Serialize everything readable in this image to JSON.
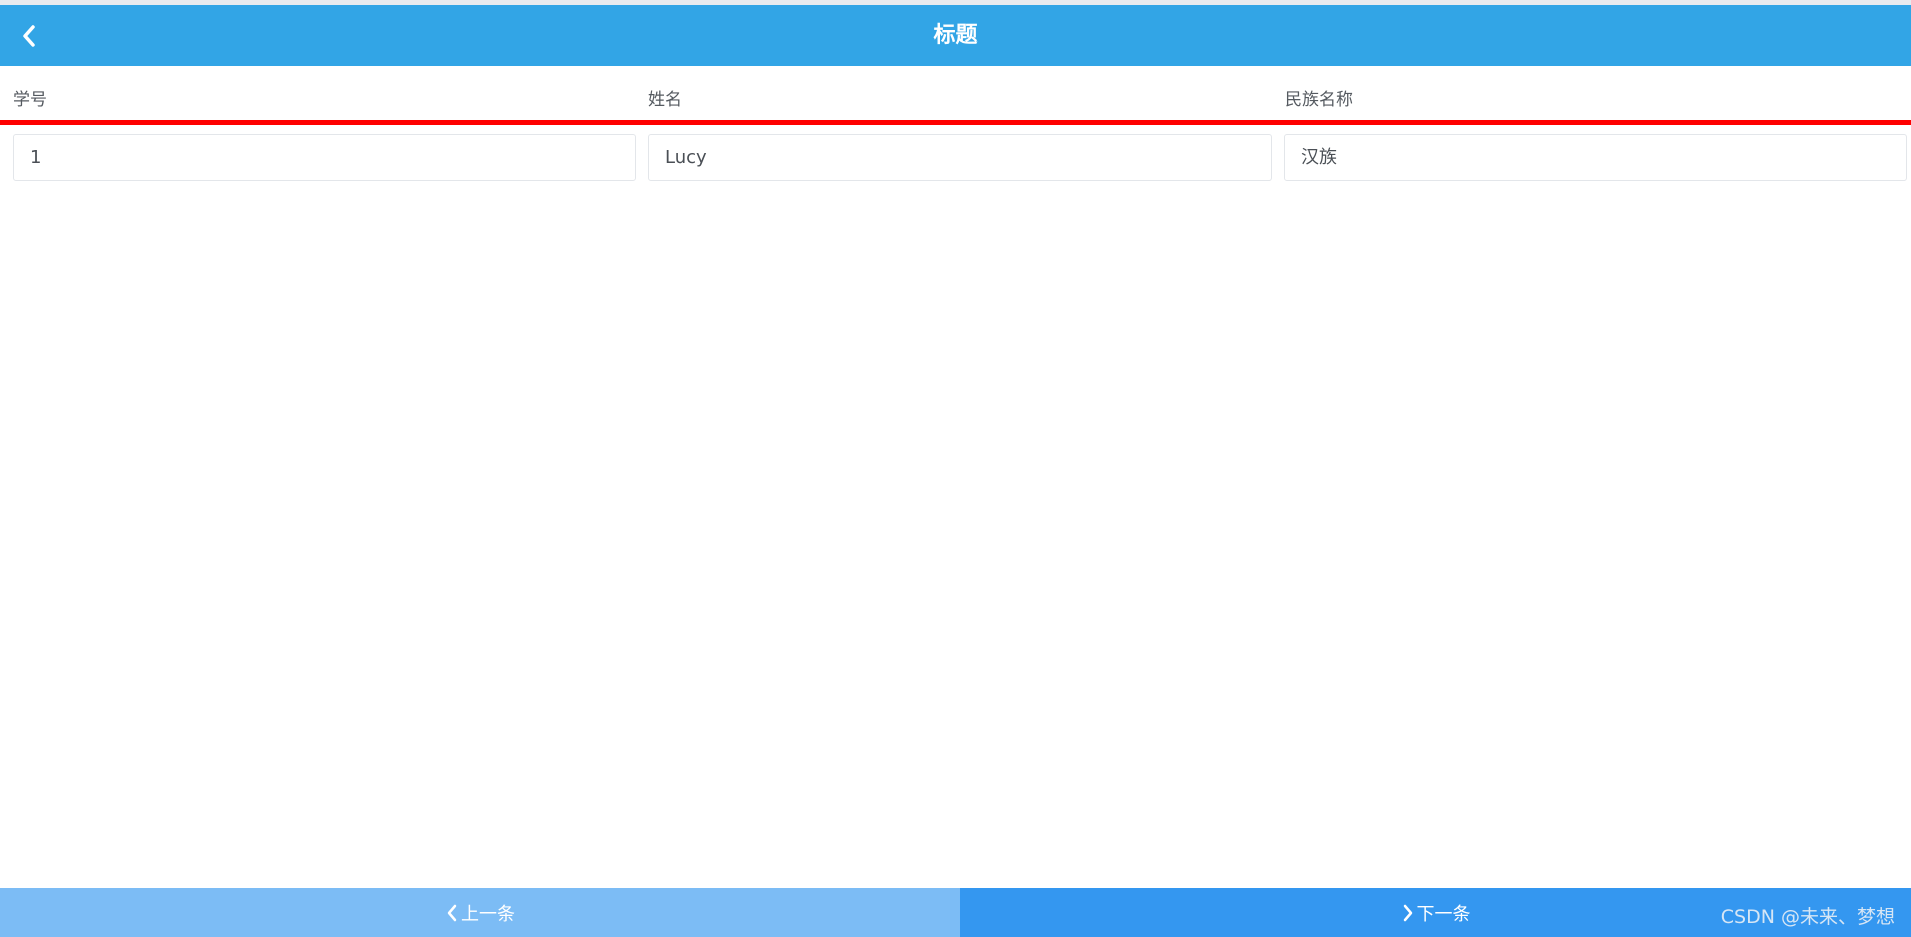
{
  "header": {
    "title": "标题",
    "back_icon": "chevron-left-icon"
  },
  "columns": [
    "学号",
    "姓名",
    "民族名称"
  ],
  "record": {
    "student_id": "1",
    "name": "Lucy",
    "ethnicity": "汉族"
  },
  "footer": {
    "prev_label": "上一条",
    "next_label": "下一条"
  },
  "watermark": "CSDN @未来、梦想",
  "colors": {
    "header_bg": "#32a5e6",
    "divider": "#ff0000",
    "prev_bg": "#7cbcf5",
    "next_bg": "#3497f0"
  }
}
